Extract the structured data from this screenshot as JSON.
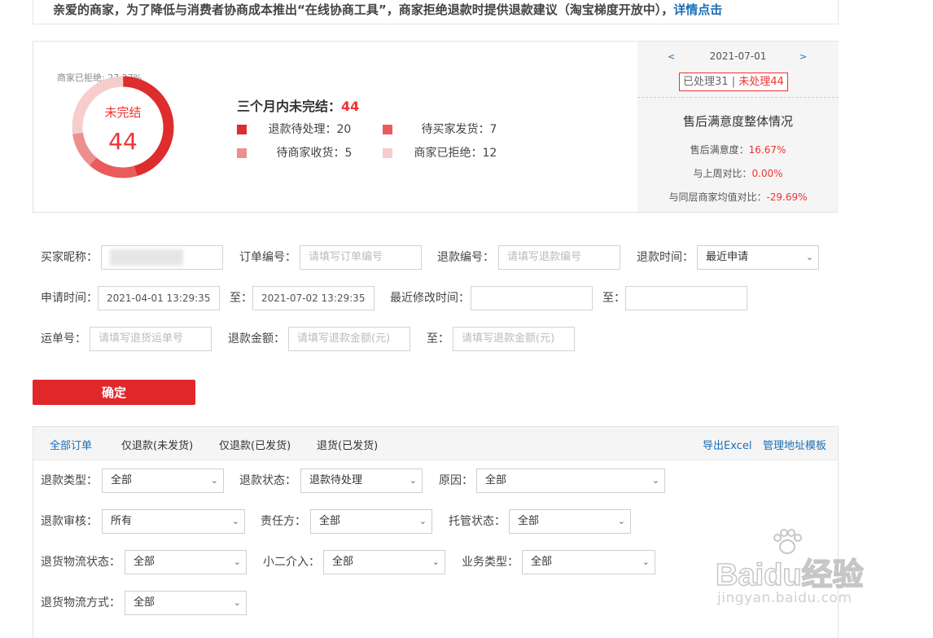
{
  "notice": {
    "text": "亲爱的商家，为了降低与消费者协商成本推出“在线协商工具”，商家拒绝退款时提供退款建议（淘宝梯度开放中），",
    "link": "详情点击"
  },
  "summary": {
    "donut_top_label": "商家已拒绝: 27.27%",
    "donut_title": "未完结",
    "donut_value": "44",
    "heading_prefix": "三个月内未完结：",
    "heading_value": "44",
    "legend": [
      {
        "label": "退款待处理：20",
        "value": 20,
        "color": "#dd2d2d"
      },
      {
        "label": "待买家发货：7",
        "value": 7,
        "color": "#ea5c5c"
      },
      {
        "label": "待商家收货：5",
        "value": 5,
        "color": "#ee8f8f"
      },
      {
        "label": "商家已拒绝：12",
        "value": 12,
        "color": "#f6cdcd"
      }
    ],
    "date_nav": {
      "prev": "<",
      "date": "2021-07-01",
      "next": ">"
    },
    "processed": "已处理31",
    "separator": "|",
    "unprocessed": "未处理44",
    "satisfaction_title": "售后满意度整体情况",
    "stats": [
      {
        "label": "售后满意度：",
        "value": "16.67%"
      },
      {
        "label": "与上周对比：",
        "value": "0.00%"
      },
      {
        "label": "与同层商家均值对比：",
        "value": "-29.69%"
      }
    ]
  },
  "filters": {
    "buyer_nick_label": "买家昵称：",
    "order_no_label": "订单编号：",
    "order_no_placeholder": "请填写订单编号",
    "refund_no_label": "退款编号：",
    "refund_no_placeholder": "请填写退款编号",
    "refund_time_label": "退款时间：",
    "refund_time_value": "最近申请",
    "apply_time_label": "申请时间：",
    "apply_time_from": "2021-04-01 13:29:35",
    "to_label": "至：",
    "apply_time_to": "2021-07-02 13:29:35",
    "modify_time_label": "最近修改时间：",
    "tracking_label": "运单号：",
    "tracking_placeholder": "请填写退货运单号",
    "amount_label": "退款金额：",
    "amount_placeholder": "请填写退款金额(元)",
    "confirm": "确定"
  },
  "orders": {
    "tabs": [
      "全部订单",
      "仅退款(未发货)",
      "仅退款(已发货)",
      "退货(已发货)"
    ],
    "export_excel": "导出Excel",
    "manage_template": "管理地址模板",
    "fields": {
      "refund_type": {
        "label": "退款类型：",
        "value": "全部"
      },
      "refund_status": {
        "label": "退款状态：",
        "value": "退款待处理"
      },
      "reason": {
        "label": "原因：",
        "value": "全部"
      },
      "refund_review": {
        "label": "退款审核：",
        "value": "所有"
      },
      "responsible": {
        "label": "责任方：",
        "value": "全部"
      },
      "custody": {
        "label": "托管状态：",
        "value": "全部"
      },
      "return_logistics_status": {
        "label": "退货物流状态：",
        "value": "全部"
      },
      "xiaoer": {
        "label": "小二介入：",
        "value": "全部"
      },
      "business_type": {
        "label": "业务类型：",
        "value": "全部"
      },
      "return_logistics_method": {
        "label": "退货物流方式：",
        "value": "全部"
      }
    }
  },
  "watermark": {
    "brand": "Baidu经验",
    "url": "jingyan.baidu.com"
  }
}
